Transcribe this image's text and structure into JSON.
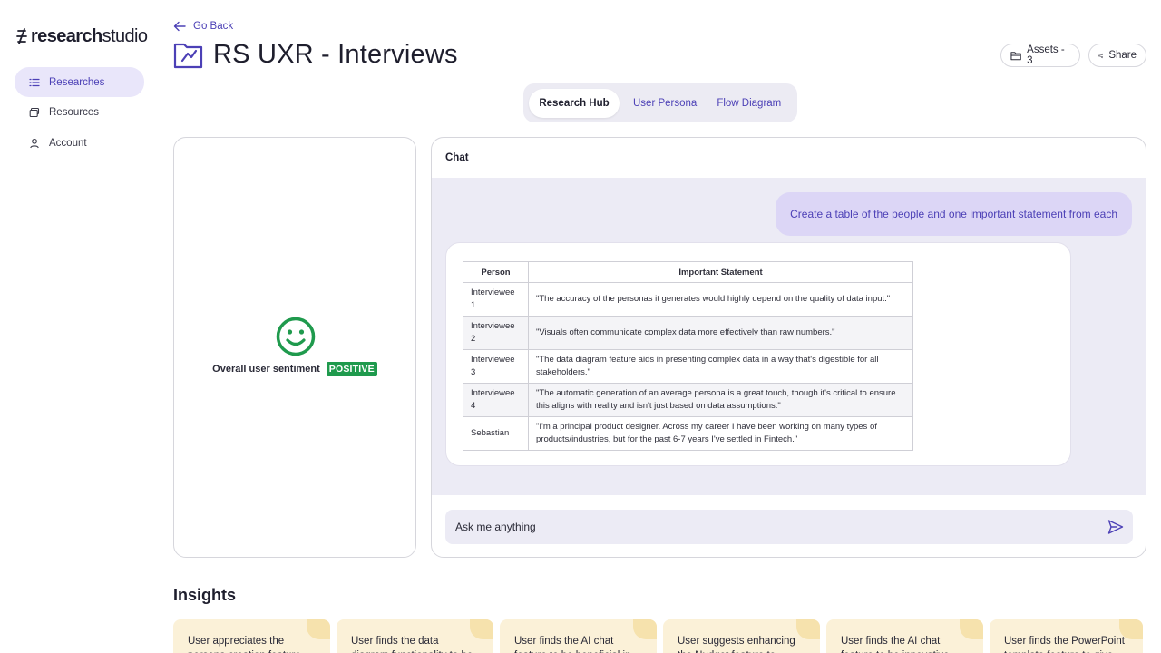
{
  "app": {
    "logo_bold": "research",
    "logo_light": "studio"
  },
  "sidebar": {
    "items": [
      {
        "label": "Researches",
        "icon": "list-icon",
        "active": true
      },
      {
        "label": "Resources",
        "icon": "stack-icon",
        "active": false
      },
      {
        "label": "Account",
        "icon": "user-icon",
        "active": false
      }
    ]
  },
  "header": {
    "back_label": "Go Back",
    "title": "RS UXR - Interviews",
    "assets_label": "Assets - 3",
    "share_label": "Share"
  },
  "tabs": [
    {
      "label": "Research Hub",
      "active": true
    },
    {
      "label": "User Persona",
      "active": false
    },
    {
      "label": "Flow Diagram",
      "active": false
    }
  ],
  "sentiment": {
    "label": "Overall user sentiment",
    "value": "POSITIVE",
    "color": "#1f9a4d"
  },
  "chat": {
    "title": "Chat",
    "user_message": "Create a table of the people and one important statement from each",
    "table": {
      "headers": [
        "Person",
        "Important Statement"
      ],
      "rows": [
        {
          "person": "Interviewee 1",
          "statement": "\"The accuracy of the personas it generates would highly depend on the quality of data input.\""
        },
        {
          "person": "Interviewee 2",
          "statement": "\"Visuals often communicate complex data more effectively than raw numbers.\""
        },
        {
          "person": "Interviewee 3",
          "statement": "\"The data diagram feature aids in presenting complex data in a way that's digestible for all stakeholders.\""
        },
        {
          "person": "Interviewee 4",
          "statement": "\"The automatic generation of an average persona is a great touch, though it's critical to ensure this aligns with reality and isn't just based on data assumptions.\""
        },
        {
          "person": "Sebastian",
          "statement": "\"I'm a principal product designer. Across my career I have been working on many types of products/industries, but for the past 6-7 years I've settled in Fintech.\""
        }
      ]
    },
    "input_placeholder": "Ask me anything"
  },
  "insights": {
    "title": "Insights",
    "cards": [
      "User appreciates the persona creation feature",
      "User finds the data diagram functionality to be",
      "User finds the AI chat feature to be beneficial in",
      "User suggests enhancing the Nudget feature to",
      "User finds the AI chat feature to be innovative",
      "User finds the PowerPoint template feature to give"
    ]
  },
  "colors": {
    "accent": "#4c40b6",
    "accent_soft": "#e9e6fa",
    "chat_bg": "#ecebf5",
    "insight_bg": "#fbf1d8"
  }
}
